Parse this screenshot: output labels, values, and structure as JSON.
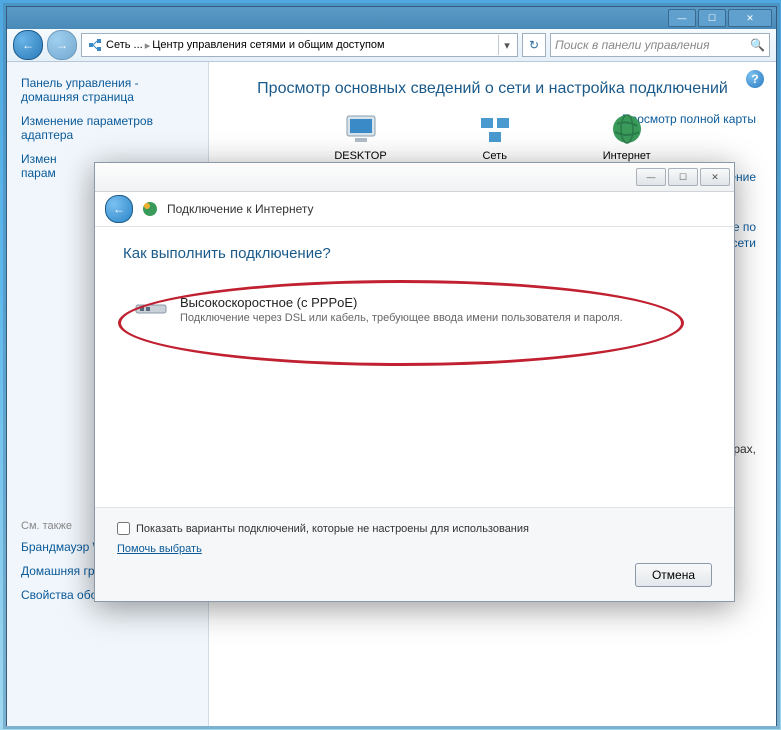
{
  "titlebar": {
    "min": "—",
    "max": "☐",
    "close": "✕"
  },
  "nav": {
    "back": "←",
    "fwd": "→",
    "crumb1": "Сеть ...",
    "crumb2": "Центр управления сетями и общим доступом",
    "sep": "▸",
    "dd": "▾",
    "refresh": "↻"
  },
  "search": {
    "placeholder": "Поиск в панели управления",
    "icon": "🔍"
  },
  "sidebar": {
    "l1": "Панель управления - домашняя страница",
    "l2": "Изменение параметров адаптера",
    "l3a": "Измен",
    "l3b": "парам",
    "seealso": "См. также",
    "l4": "Брандмауэр Windows",
    "l5": "Домашняя группа",
    "l6": "Свойства обозревателя"
  },
  "main": {
    "heading": "Просмотр основных сведений о сети и настройка подключений",
    "fullmap": "Просмотр полной карты",
    "desktop": "DESKTOP",
    "network": "Сеть",
    "internet": "Интернет",
    "p1": "лючение",
    "p2": "ние по",
    "p3": "сети",
    "p4": "терах,"
  },
  "dialog": {
    "wmin": "—",
    "wmax": "☐",
    "wclose": "✕",
    "back": "←",
    "title": "Подключение к Интернету",
    "question": "Как выполнить подключение?",
    "opt_title": "Высокоскоростное (с PPPoE)",
    "opt_desc": "Подключение через DSL или кабель, требующее ввода имени пользователя и пароля.",
    "chk": "Показать варианты подключений, которые не настроены для использования",
    "help": "Помочь выбрать",
    "cancel": "Отмена"
  },
  "help": "?"
}
